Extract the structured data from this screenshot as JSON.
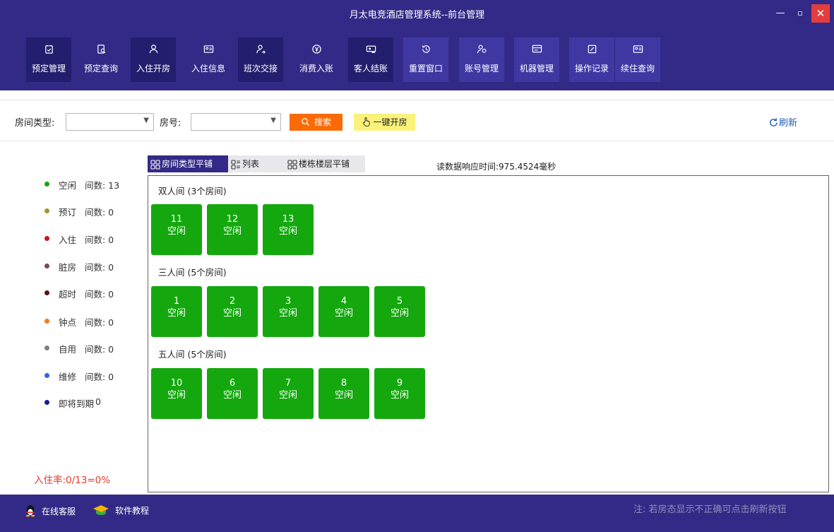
{
  "window": {
    "title": "月太电竞酒店管理系统--前台管理",
    "close_color": "#e43d3d"
  },
  "toolbar": {
    "items": [
      {
        "label": "预定管理",
        "icon": "calendar-check-icon"
      },
      {
        "label": "预定查询",
        "icon": "search-doc-icon"
      },
      {
        "label": "入住开房",
        "icon": "person-icon"
      },
      {
        "label": "入住信息",
        "icon": "id-card-icon"
      },
      {
        "label": "班次交接",
        "icon": "handover-icon"
      },
      {
        "label": "消费入账",
        "icon": "yen-circle-icon"
      },
      {
        "label": "客人结账",
        "icon": "checkout-card-icon"
      },
      {
        "label": "重置窗口",
        "icon": "reset-clock-icon"
      },
      {
        "label": "账号管理",
        "icon": "users-icon"
      },
      {
        "label": "机器管理",
        "icon": "monitor-icon"
      },
      {
        "label": "操作记录",
        "icon": "edit-log-icon"
      },
      {
        "label": "续住查询",
        "icon": "id-card-search-icon"
      }
    ]
  },
  "filters": {
    "room_type_label": "房间类型:",
    "room_type_value": "",
    "room_no_label": "房号:",
    "room_no_value": "",
    "search_label": "搜索",
    "quick_open_label": "一键开房",
    "refresh_label": "刷新"
  },
  "colors": {
    "accent": "#332a87",
    "room_free": "#14a80e",
    "search": "#fa6b07",
    "quick_open": "#faf27a"
  },
  "status_legend": [
    {
      "name": "空闲",
      "count": "间数: 13",
      "color": "#14a80e"
    },
    {
      "name": "预订",
      "count": "间数: 0",
      "color": "#9a9a26"
    },
    {
      "name": "入住",
      "count": "间数: 0",
      "color": "#c8161e"
    },
    {
      "name": "脏房",
      "count": "间数: 0",
      "color": "#7a4a4a"
    },
    {
      "name": "超时",
      "count": "间数: 0",
      "color": "#5a1212"
    },
    {
      "name": "钟点",
      "count": "间数: 0",
      "color": "#f07a1e"
    },
    {
      "name": "自用",
      "count": "间数: 0",
      "color": "#808080"
    },
    {
      "name": "维修",
      "count": "间数: 0",
      "color": "#3a5fe0"
    },
    {
      "name": "即将到期",
      "count": "0",
      "color": "#1a1aa0"
    }
  ],
  "occupancy": "入住率:0/13=0%",
  "view_tabs": [
    "房间类型平铺",
    "列表",
    "楼栋楼层平铺"
  ],
  "read_time": "读数据响应时间:975.4524毫秒",
  "room_groups": [
    {
      "title": "双人间  (3个房间)",
      "rooms": [
        {
          "number": "11",
          "status": "空闲"
        },
        {
          "number": "12",
          "status": "空闲"
        },
        {
          "number": "13",
          "status": "空闲"
        }
      ]
    },
    {
      "title": "三人间  (5个房间)",
      "rooms": [
        {
          "number": "1",
          "status": "空闲"
        },
        {
          "number": "2",
          "status": "空闲"
        },
        {
          "number": "3",
          "status": "空闲"
        },
        {
          "number": "4",
          "status": "空闲"
        },
        {
          "number": "5",
          "status": "空闲"
        }
      ]
    },
    {
      "title": "五人间  (5个房间)",
      "rooms": [
        {
          "number": "10",
          "status": "空闲"
        },
        {
          "number": "6",
          "status": "空闲"
        },
        {
          "number": "7",
          "status": "空闲"
        },
        {
          "number": "8",
          "status": "空闲"
        },
        {
          "number": "9",
          "status": "空闲"
        }
      ]
    }
  ],
  "footer": {
    "service_label": "在线客服",
    "tutorial_label": "软件教程",
    "note": "注: 若房态显示不正确可点击刷新按钮"
  }
}
